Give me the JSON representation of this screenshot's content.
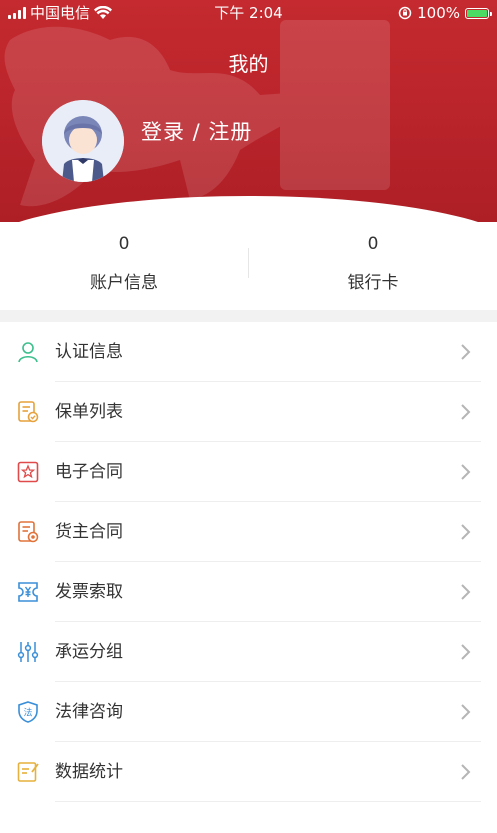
{
  "status_bar": {
    "carrier": "中国电信",
    "time": "下午 2:04",
    "battery": "100%",
    "battery_level": 1.0
  },
  "header": {
    "title": "我的",
    "login_label": "登录 / 注册"
  },
  "stats": [
    {
      "value": "0",
      "label": "账户信息"
    },
    {
      "value": "0",
      "label": "银行卡"
    }
  ],
  "menu": [
    {
      "label": "认证信息",
      "icon": "user-icon",
      "color": "#3cbf8c"
    },
    {
      "label": "保单列表",
      "icon": "policy-list-icon",
      "color": "#e6a23c"
    },
    {
      "label": "电子合同",
      "icon": "e-contract-icon",
      "color": "#e04a4a"
    },
    {
      "label": "货主合同",
      "icon": "shipper-contract-icon",
      "color": "#e0733a"
    },
    {
      "label": "发票索取",
      "icon": "invoice-icon",
      "color": "#3a8fd8"
    },
    {
      "label": "承运分组",
      "icon": "sliders-icon",
      "color": "#3a8fd8"
    },
    {
      "label": "法律咨询",
      "icon": "law-shield-icon",
      "color": "#3a8fd8"
    },
    {
      "label": "数据统计",
      "icon": "statistics-icon",
      "color": "#e6b13c"
    }
  ],
  "colors": {
    "brand_red": "#b8232a",
    "divider": "#eeeeee",
    "chevron": "#b5b5b5"
  }
}
